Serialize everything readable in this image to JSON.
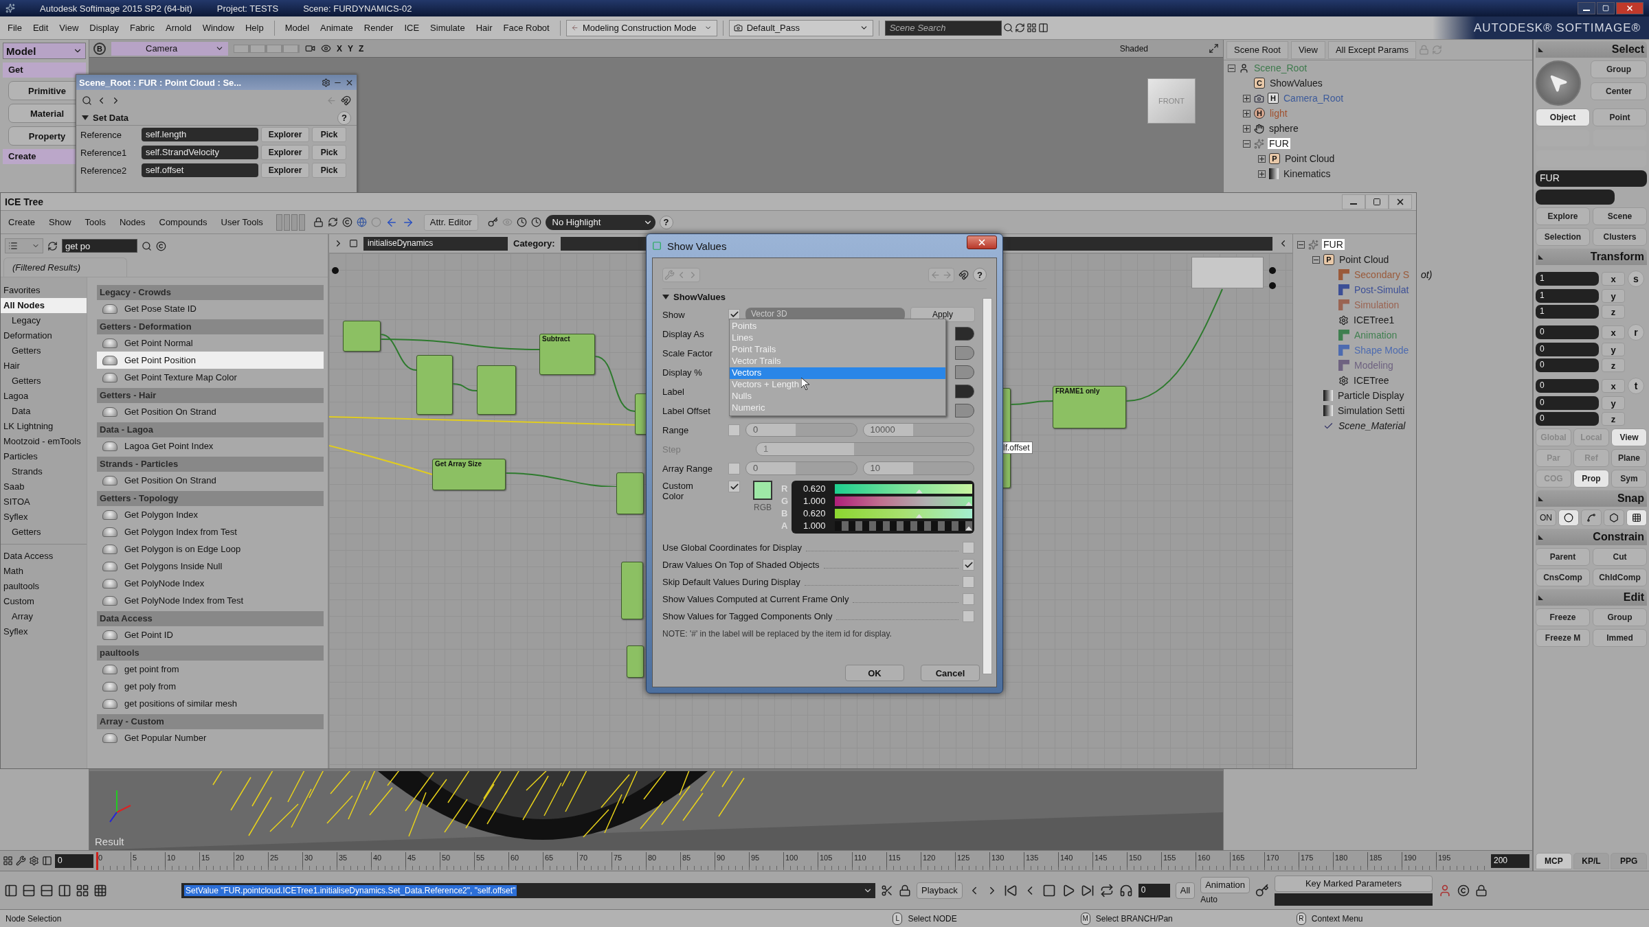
{
  "title_bar": {
    "title": "Autodesk Softimage 2015 SP2 (64-bit)",
    "project": "Project: TESTS",
    "scene": "Scene: FURDYNAMICS-02"
  },
  "menu_bar": {
    "menus": [
      "File",
      "Edit",
      "View",
      "Display",
      "Fabric",
      "Arnold",
      "Window",
      "Help"
    ],
    "modules": [
      "Model",
      "Animate",
      "Render",
      "ICE",
      "Simulate",
      "Hair",
      "Face Robot"
    ],
    "mode": "Modeling Construction Mode",
    "pass": "Default_Pass",
    "search": {
      "placeholder": "Scene Search"
    },
    "brand": "AUTODESK® SOFTIMAGE®"
  },
  "toolbar": {
    "module": "Model",
    "items": [
      {
        "label": "Get",
        "kind": "header"
      },
      {
        "label": "Primitive",
        "kind": "button"
      },
      {
        "label": "Material",
        "kind": "button"
      },
      {
        "label": "Property",
        "kind": "button"
      },
      {
        "label": "Create",
        "kind": "header"
      }
    ]
  },
  "viewport": {
    "badge": "B",
    "camera": "Camera",
    "axes": [
      "X",
      "Y",
      "Z"
    ],
    "shading": "Shaded",
    "cube_label": "FRONT",
    "result_label": "Result"
  },
  "property_window": {
    "title": "Scene_Root : FUR : Point Cloud : Se...",
    "section": "Set Data",
    "help": "?",
    "rows": [
      {
        "label": "Reference",
        "value": "self.length",
        "explorer": "Explorer",
        "pick": "Pick"
      },
      {
        "label": "Reference1",
        "value": "self.StrandVelocity",
        "explorer": "Explorer",
        "pick": "Pick"
      },
      {
        "label": "Reference2",
        "value": "self.offset",
        "explorer": "Explorer",
        "pick": "Pick"
      }
    ]
  },
  "explorer": {
    "buttons": [
      "Scene Root",
      "View",
      "All Except Params"
    ],
    "tree": [
      {
        "label": "Scene_Root",
        "kind": "model",
        "color": "#3d7a4c",
        "selected": false,
        "expanded": true,
        "children": [
          {
            "label": "ShowValues",
            "kind": "lettered",
            "badge": "C",
            "color": "#1a1a1a",
            "selected": false
          },
          {
            "label": "Camera_Root",
            "kind": "camera",
            "badge": "H",
            "color": "#3c5a9a",
            "selected": false,
            "expanded": false
          },
          {
            "label": "light",
            "kind": "light",
            "badge": "H",
            "color": "#a0502e",
            "selected": false,
            "expanded": false
          },
          {
            "label": "sphere",
            "kind": "mesh",
            "color": "#1a1a1a",
            "selected": false,
            "expanded": false
          },
          {
            "label": "FUR",
            "kind": "strands",
            "color": "#1a1a1a",
            "selected": true,
            "expanded": true,
            "children": [
              {
                "label": "Point Cloud",
                "kind": "lettered",
                "badge": "P",
                "color": "#1a1a1a",
                "selected": false,
                "expanded": false
              },
              {
                "label": "Kinematics",
                "kind": "property",
                "color": "#1a1a1a",
                "selected": false,
                "expanded": false
              }
            ]
          }
        ]
      }
    ]
  },
  "ice_tree": {
    "title": "ICE Tree",
    "menus": [
      "Create",
      "Show",
      "Tools",
      "Nodes",
      "Compounds",
      "User Tools"
    ],
    "attr_editor": "Attr. Editor",
    "highlight": "No Highlight",
    "help": "?",
    "search": {
      "value": "get po"
    },
    "filter_tab": "(Filtered Results)",
    "categories": [
      {
        "label": "Favorites",
        "selected": false
      },
      {
        "label": "All Nodes",
        "selected": true,
        "children": [
          {
            "label": "Legacy",
            "selected": false
          }
        ]
      },
      {
        "label": "Deformation",
        "selected": false,
        "children": [
          {
            "label": "Getters",
            "selected": false
          }
        ]
      },
      {
        "label": "Hair",
        "selected": false,
        "children": [
          {
            "label": "Getters",
            "selected": false
          }
        ]
      },
      {
        "label": "Lagoa",
        "selected": false,
        "children": [
          {
            "label": "Data",
            "selected": false
          }
        ]
      },
      {
        "label": "LK Lightning",
        "selected": false
      },
      {
        "label": "Mootzoid - emTools",
        "selected": false
      },
      {
        "label": "Particles",
        "selected": false,
        "children": [
          {
            "label": "Strands",
            "selected": false
          }
        ]
      },
      {
        "label": "Saab",
        "selected": false
      },
      {
        "label": "SITOA",
        "selected": false
      },
      {
        "label": "Syflex",
        "selected": false,
        "children": [
          {
            "label": "Getters",
            "selected": false
          }
        ]
      }
    ],
    "tool_categories": [
      {
        "label": "Data Access",
        "selected": false
      },
      {
        "label": "Math",
        "selected": false
      },
      {
        "label": "paultools",
        "selected": false
      },
      {
        "label": "Custom",
        "selected": false,
        "children": [
          {
            "label": "Array",
            "selected": false
          }
        ]
      },
      {
        "label": "Syflex",
        "selected": false
      }
    ],
    "results": [
      {
        "group": "Legacy - Crowds",
        "items": [
          {
            "label": "Get Pose State ID",
            "selected": false
          }
        ]
      },
      {
        "group": "Getters - Deformation",
        "items": [
          {
            "label": "Get Point Normal",
            "selected": false
          },
          {
            "label": "Get Point Position",
            "selected": true
          },
          {
            "label": "Get Point Texture Map Color",
            "selected": false
          }
        ]
      },
      {
        "group": "Getters - Hair",
        "items": [
          {
            "label": "Get Position On Strand",
            "selected": false
          }
        ]
      },
      {
        "group": "Data - Lagoa",
        "items": [
          {
            "label": "Lagoa Get Point Index",
            "selected": false
          }
        ]
      },
      {
        "group": "Strands - Particles",
        "items": [
          {
            "label": "Get Position On Strand",
            "selected": false
          }
        ]
      },
      {
        "group": "Getters - Topology",
        "items": [
          {
            "label": "Get Polygon Index",
            "selected": false
          },
          {
            "label": "Get Polygon Index from Test",
            "selected": false
          },
          {
            "label": "Get Polygon is on Edge Loop",
            "selected": false
          },
          {
            "label": "Get Polygons Inside Null",
            "selected": false
          },
          {
            "label": "Get PolyNode Index",
            "selected": false
          },
          {
            "label": "Get PolyNode Index from Test",
            "selected": false
          }
        ]
      },
      {
        "group": "Data Access",
        "items": [
          {
            "label": "Get Point ID",
            "selected": false
          }
        ]
      },
      {
        "group": "paultools",
        "items": [
          {
            "label": "get point from",
            "selected": false
          },
          {
            "label": "get poly from",
            "selected": false
          },
          {
            "label": "get positions of similar mesh",
            "selected": false
          }
        ]
      },
      {
        "group": "Array - Custom",
        "items": [
          {
            "label": "Get Popular Number",
            "selected": false
          }
        ]
      }
    ],
    "path": "initialiseDynamics",
    "category_label": "Category:",
    "nodes": [
      {
        "title": "Subtract"
      },
      {
        "title": "Get Array Size"
      },
      {
        "title": "FRAME1 only"
      }
    ],
    "tag": "lf.offset",
    "scene_tree": [
      {
        "label": "FUR",
        "kind": "strands",
        "color": "#1a1a1a",
        "selected": true,
        "expanded": true,
        "children": [
          {
            "label": "Point Cloud",
            "kind": "lettered",
            "badge": "P",
            "color": "#1a1a1a",
            "selected": false,
            "expanded": true,
            "children": [
              {
                "label": "Secondary S",
                "overflow": "ot)",
                "kind": "operator",
                "color": "#9a5a3a",
                "selected": false
              },
              {
                "label": "Post-Simulat",
                "kind": "operator",
                "color": "#3c4f96",
                "selected": false
              },
              {
                "label": "Simulation",
                "kind": "operator",
                "color": "#9a6452",
                "selected": false
              },
              {
                "label": "ICETree1",
                "kind": "tree",
                "color": "#1a1a1a",
                "selected": false
              },
              {
                "label": "Animation",
                "kind": "operator",
                "color": "#3f7f4f",
                "selected": false
              },
              {
                "label": "Shape Mode",
                "kind": "operator",
                "color": "#4d6bb0",
                "selected": false
              },
              {
                "label": "Modeling",
                "kind": "operator",
                "color": "#6e6280",
                "selected": false
              },
              {
                "label": "ICETree",
                "kind": "tree",
                "color": "#1a1a1a",
                "selected": false
              }
            ]
          },
          {
            "label": "Particle Display",
            "kind": "property",
            "color": "#1a1a1a",
            "selected": false
          },
          {
            "label": "Simulation Setti",
            "kind": "property",
            "color": "#1a1a1a",
            "selected": false
          },
          {
            "label": "Scene_Material",
            "kind": "material",
            "color": "#1a1a1a",
            "selected": false,
            "italic": true
          }
        ]
      }
    ]
  },
  "show_values": {
    "title": "Show Values",
    "section": "ShowValues",
    "help": "?",
    "rows": [
      {
        "label": "Show",
        "kind": "show",
        "checked": true,
        "value": "Vector 3D",
        "button": "Apply"
      },
      {
        "label": "Display As",
        "kind": "dropdown"
      },
      {
        "label": "Scale Factor",
        "kind": "number"
      },
      {
        "label": "Display %",
        "kind": "number"
      },
      {
        "label": "Label",
        "kind": "dropdown"
      },
      {
        "label": "Label Offset",
        "kind": "number"
      },
      {
        "label": "Range",
        "kind": "range",
        "checked": false,
        "from": "0",
        "to": "10000"
      },
      {
        "label": "Step",
        "kind": "step",
        "disabled": true,
        "value": "1"
      },
      {
        "label": "Array Range",
        "kind": "range",
        "checked": false,
        "from": "0",
        "to": "10"
      }
    ],
    "custom_color": {
      "label": "Custom Color",
      "checked": true,
      "color": "#9ee8a6",
      "mode": "RGB",
      "channels": [
        {
          "name": "R",
          "value": "0.620",
          "level": 0.62
        },
        {
          "name": "G",
          "value": "1.000",
          "level": 1
        },
        {
          "name": "B",
          "value": "0.620",
          "level": 0.62
        },
        {
          "name": "A",
          "value": "1.000",
          "level": 1
        }
      ]
    },
    "options": [
      {
        "label": "Use Global Coordinates for Display",
        "checked": false
      },
      {
        "label": "Draw Values On Top of Shaded Objects",
        "checked": true
      },
      {
        "label": "Skip Default Values During Display",
        "checked": false
      },
      {
        "label": "Show Values Computed at Current Frame Only",
        "checked": false
      },
      {
        "label": "Show Values for Tagged Components Only",
        "checked": false
      }
    ],
    "note": "NOTE: '#' in the label will be replaced by the item id for display.",
    "list": [
      {
        "label": "Points",
        "selected": false
      },
      {
        "label": "Lines",
        "selected": false
      },
      {
        "label": "Point Trails",
        "selected": false
      },
      {
        "label": "Vector Trails",
        "selected": false
      },
      {
        "label": "Vectors",
        "selected": true
      },
      {
        "label": "Vectors + Length",
        "selected": false
      },
      {
        "label": "Nulls",
        "selected": false
      },
      {
        "label": "Numeric",
        "selected": false
      }
    ],
    "buttons": [
      "OK",
      "Cancel"
    ]
  },
  "mcp": {
    "select": {
      "header": "Select",
      "buttons": [
        "Group",
        "Center"
      ],
      "modes": [
        {
          "label": "Object",
          "selected": true
        },
        {
          "label": "Point",
          "selected": false
        }
      ],
      "name_field": "FUR",
      "nav": [
        "Explore",
        "Scene",
        "Selection",
        "Clusters"
      ]
    },
    "transform": {
      "header": "Transform",
      "groups": [
        {
          "key": "s",
          "values": [
            "1",
            "1",
            "1"
          ],
          "axes": [
            "x",
            "y",
            "z"
          ]
        },
        {
          "key": "r",
          "values": [
            "0",
            "0",
            "0"
          ],
          "axes": [
            "x",
            "y",
            "z"
          ]
        },
        {
          "key": "t",
          "values": [
            "0",
            "0",
            "0"
          ],
          "axes": [
            "x",
            "y",
            "z"
          ]
        }
      ],
      "option_rows": [
        [
          {
            "label": "Global",
            "selected": false,
            "dimmed": true
          },
          {
            "label": "Local",
            "selected": false,
            "dimmed": true
          },
          {
            "label": "View",
            "selected": true,
            "dimmed": false
          }
        ],
        [
          {
            "label": "Par",
            "selected": false,
            "dimmed": true
          },
          {
            "label": "Ref",
            "selected": false,
            "dimmed": true
          },
          {
            "label": "Plane",
            "selected": false,
            "dimmed": false
          }
        ],
        [
          {
            "label": "COG",
            "selected": false,
            "dimmed": true
          },
          {
            "label": "Prop",
            "selected": true,
            "dimmed": false
          },
          {
            "label": "Sym",
            "selected": false,
            "dimmed": false
          }
        ]
      ]
    },
    "snap": {
      "header": "Snap",
      "on": "ON",
      "tools": [
        {
          "kind": "point",
          "selected": true
        },
        {
          "kind": "curve",
          "selected": false
        },
        {
          "kind": "polygon",
          "selected": false
        },
        {
          "kind": "grid",
          "selected": true
        }
      ]
    },
    "constrain": {
      "header": "Constrain",
      "buttons": [
        "Parent",
        "Cut",
        "CnsComp",
        "ChldComp"
      ]
    },
    "edit": {
      "header": "Edit",
      "buttons": [
        "Freeze",
        "Group",
        "Freeze M",
        "Immed"
      ]
    },
    "tabs": [
      {
        "label": "MCP",
        "selected": true
      },
      {
        "label": "KP/L",
        "selected": false
      },
      {
        "label": "PPG",
        "selected": false
      }
    ]
  },
  "timeline": {
    "start": "0",
    "end": "200",
    "ticks": [
      "0",
      "5",
      "10",
      "15",
      "20",
      "25",
      "30",
      "35",
      "40",
      "45",
      "50",
      "55",
      "60",
      "65",
      "70",
      "75",
      "80",
      "85",
      "90",
      "95",
      "100",
      "105",
      "110",
      "115",
      "120",
      "125",
      "130",
      "135",
      "140",
      "145",
      "150",
      "155",
      "160",
      "165",
      "170",
      "175",
      "180",
      "185",
      "190",
      "195"
    ]
  },
  "command": {
    "text": "SetValue \"FUR.pointcloud.ICETree1.initialiseDynamics.Set_Data.Reference2\", \"self.offset\""
  },
  "playback": {
    "label": "Playback",
    "frame": "0",
    "range": "All",
    "animation": "Animation",
    "auto": "Auto",
    "key_marked": "Key Marked Parameters"
  },
  "status_bar": {
    "mode": "Node Selection",
    "mouse": [
      {
        "button": "L",
        "action": "Select NODE"
      },
      {
        "button": "M",
        "action": "Select BRANCH/Pan"
      },
      {
        "button": "R",
        "action": "Context Menu"
      }
    ]
  }
}
